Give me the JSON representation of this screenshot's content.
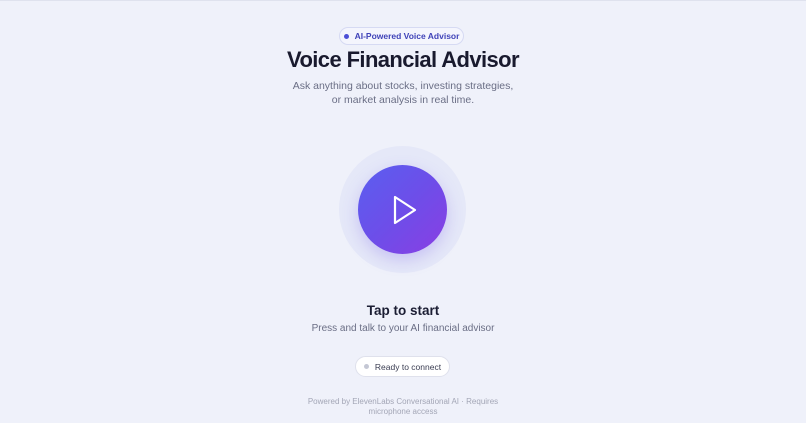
{
  "badge": {
    "label": "AI-Powered Voice Advisor"
  },
  "header": {
    "title": "Voice Financial Advisor",
    "subtitle_line1": "Ask anything about stocks, investing strategies,",
    "subtitle_line2": "or market analysis in real time."
  },
  "play_button": {
    "icon": "play-icon"
  },
  "cta": {
    "title": "Tap to start",
    "subtitle": "Press and talk to your AI financial advisor"
  },
  "status": {
    "label": "Ready to connect"
  },
  "footer": {
    "line1": "Powered by ElevenLabs Conversational AI · Requires",
    "line2": "microphone access"
  },
  "colors": {
    "background": "#eff1fa",
    "accent": "#4c4fd6",
    "gradient_start": "#5a5ff0",
    "gradient_end": "#8a3ee3"
  }
}
